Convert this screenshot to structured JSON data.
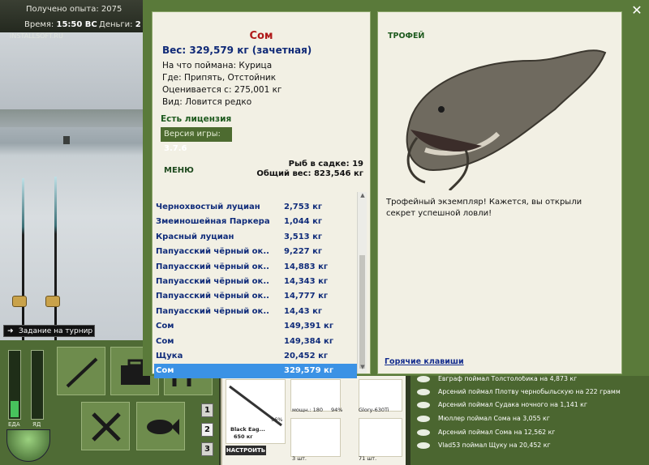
{
  "topbar": {
    "xp_label": "Получено опыта: 2075",
    "time_label": "Время:",
    "time_value": "15:50 ВС",
    "money_label": "Деньги:",
    "money_value": "2",
    "brand": "INSTALLSOFT.RU"
  },
  "scene": {
    "tournament_label": "Задание на турнир"
  },
  "meters": {
    "food_label": "ЕДА",
    "poison_label": "ЯД",
    "food_level": 0.25,
    "poison_level": 0.0
  },
  "pager": [
    "1",
    "2",
    "3"
  ],
  "inventory": {
    "rod_name": "Black Eag...",
    "rod_weight": "650 кг",
    "percent1": "96%",
    "reel_caption": "мощн.: 180",
    "percent2": "94%",
    "line_caption": "Glory-630Ti",
    "count1": "3 шт.",
    "count2": "71 шт.",
    "tune_button": "НАСТРОИТЬ"
  },
  "news": [
    "Евграф поймал Толстолобика на 4,873 кг",
    "Арсений поймал Плотву чернобыльскую на 222 грамм",
    "Арсений поймал Судака ночного на 1,141 кг",
    "Мюллер поймал Сома на 3,055 кг",
    "Арсений поймал Сома на 12,562 кг",
    "Vlad53 поймал Щуку на 20,452 кг"
  ],
  "fish_card": {
    "name": "Сом",
    "weight": "Вес: 329,579 кг (зачетная)",
    "bait": "На что поймана: Курица",
    "place": "Где: Припять, Отстойник",
    "value": "Оценивается с: 275,001 кг",
    "type": "Вид: Ловится редко",
    "license": "Есть лицензия",
    "version_label": "Версия игры:",
    "version_value": "3.7.6",
    "menu": "МЕНЮ",
    "keep_count": "Рыб в садке: 19",
    "keep_weight": "Общий вес: 823,546 кг"
  },
  "catch_list": [
    {
      "name": "Чернохвостый луциан",
      "weight": "2,753 кг"
    },
    {
      "name": "Змеиношейная Паркера",
      "weight": "1,044 кг"
    },
    {
      "name": "Красный луциан",
      "weight": "3,513 кг"
    },
    {
      "name": "Папуасский чёрный ок...",
      "weight": "9,227 кг"
    },
    {
      "name": "Папуасский чёрный ок...",
      "weight": "14,883 кг"
    },
    {
      "name": "Папуасский чёрный ок...",
      "weight": "14,343 кг"
    },
    {
      "name": "Папуасский чёрный ок...",
      "weight": "14,777 кг"
    },
    {
      "name": "Папуасский чёрный ок...",
      "weight": "14,43 кг"
    },
    {
      "name": "Сом",
      "weight": "149,391 кг"
    },
    {
      "name": "Сом",
      "weight": "149,384 кг"
    },
    {
      "name": "Щука",
      "weight": "20,452 кг"
    },
    {
      "name": "Сом",
      "weight": "329,579 кг",
      "selected": true
    }
  ],
  "trophy": {
    "title": "ТРОФЕЙ",
    "text": "Трофейный экземпляр! Кажется, вы открыли секрет успешной ловли!",
    "hotkeys": "Горячие клавиши"
  },
  "colors": {
    "panel_green": "#5a7a3a",
    "card_bg": "#f2f0e4",
    "list_blue": "#102c7a",
    "selection": "#3b92e5",
    "fish_red": "#b01b1b"
  }
}
